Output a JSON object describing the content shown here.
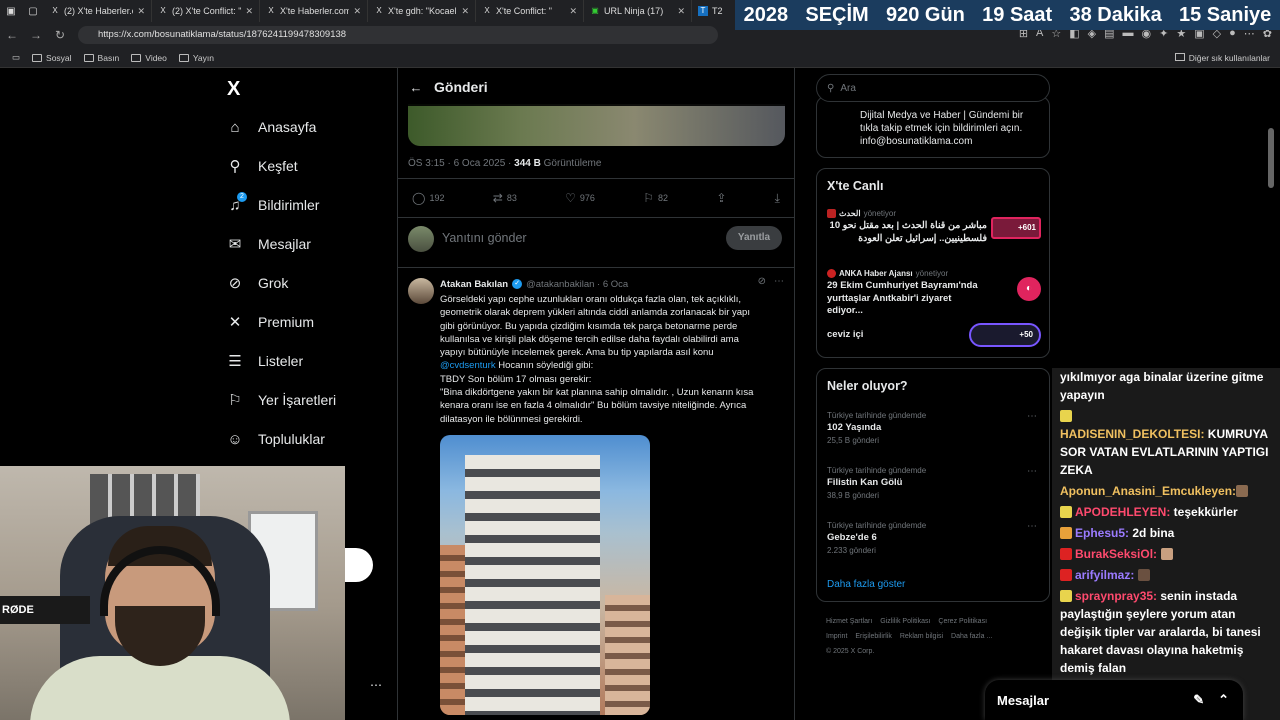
{
  "browser": {
    "tabs": [
      {
        "icon": "X",
        "label": "(2) X'te Haberler.co"
      },
      {
        "icon": "X",
        "label": "(2) X'te Conflict: \""
      },
      {
        "icon": "X",
        "label": "X'te Haberler.com:"
      },
      {
        "icon": "X",
        "label": "X'te gdh: \"Kocaeli"
      },
      {
        "icon": "X",
        "label": "X'te Conflict: \""
      },
      {
        "icon": "▣",
        "label": "URL Ninja (17)"
      },
      {
        "icon": "T",
        "label": "T2"
      }
    ],
    "url": "https://x.com/bosunatiklama/status/1876241199478309138",
    "bookmarks": [
      "Sosyal",
      "Basın",
      "Video",
      "Yayın"
    ],
    "bookmarks_other": "Diğer sık kullanılanlar"
  },
  "countdown": {
    "year": "2028",
    "label": "SEÇİM",
    "days": "920 Gün",
    "hours": "19 Saat",
    "minutes": "38 Dakika",
    "seconds": "15 Saniye"
  },
  "sidebar": {
    "logo": "X",
    "items": [
      {
        "label": "Anasayfa",
        "icon": "home-icon"
      },
      {
        "label": "Keşfet",
        "icon": "search-icon"
      },
      {
        "label": "Bildirimler",
        "icon": "bell-icon",
        "badge": "2"
      },
      {
        "label": "Mesajlar",
        "icon": "mail-icon"
      },
      {
        "label": "Grok",
        "icon": "grok-icon"
      },
      {
        "label": "Premium",
        "icon": "x-icon"
      },
      {
        "label": "Listeler",
        "icon": "list-icon"
      },
      {
        "label": "Yer İşaretleri",
        "icon": "bookmark-icon"
      },
      {
        "label": "Topluluklar",
        "icon": "people-icon"
      }
    ],
    "more": "..."
  },
  "post": {
    "header_title": "Gönderi",
    "time": "ÖS 3:15 · 6 Oca 2025 ·",
    "views": "344 B",
    "views_label": "Görüntüleme",
    "replies": "192",
    "reposts": "83",
    "likes": "976",
    "bookmarks": "82",
    "reply_placeholder": "Yanıtını gönder",
    "reply_button": "Yanıtla"
  },
  "reply_tweet": {
    "name": "Atakan Bakılan",
    "handle": "@atakanbakilan · 6 Oca",
    "lines": [
      "Görseldeki yapı cephe uzunlukları oranı oldukça fazla olan, tek açıklıklı,",
      "geometrik olarak deprem yükleri altında ciddi anlamda zorlanacak bir yapı",
      "gibi görünüyor. Bu yapıda çizdiğim kısımda tek parça betonarme perde",
      "kullanılsa ve kirişli plak döşeme tercih edilse daha faydalı olabilirdi ama",
      "yapıyı bütünüyle incelemek gerek. Ama bu tip yapılarda asıl konu"
    ],
    "mention": "@cvdsenturk",
    "mention_rest": " Hocanın söylediği gibi:",
    "lines2": [
      " TBDY Son bölüm 17 olması gerekir:",
      "\"Bina dikdörtgene yakın bir kat planına sahip olmalıdır. , Uzun kenarın kısa",
      "kenara oranı ise en fazla 4 olmalıdır\" Bu bölüm tavsiye niteliğinde. Ayrıca",
      "dilatasyon ile bölünmesi gerekirdi."
    ]
  },
  "right": {
    "search_placeholder": "Ara",
    "promo_text": "Dijital Medya ve Haber | Gündemi bir tıkla takip etmek için bildirimleri açın. info@bosunatiklama.com",
    "live_title": "X'te Canlı",
    "live": [
      {
        "host": "الحدث",
        "role": "yönetiyor",
        "title": "مباشر من قناة الحدث | بعد مقتل نحو 10 فلسطينيين.. إسرائيل تعلن العودة",
        "count": "+601"
      },
      {
        "host": "ANKA Haber Ajansı",
        "role": "yönetiyor",
        "title": "29 Ekim Cumhuriyet Bayramı'nda yurttaşlar Anıtkabir'i ziyaret ediyor..."
      },
      {
        "host": "",
        "role": "",
        "title": "ceviz içi",
        "count": "+50"
      }
    ],
    "trends_title": "Neler oluyor?",
    "trends": [
      {
        "category": "Türkiye tarihinde gündemde",
        "name": "102 Yaşında",
        "count": "25,5 B gönderi"
      },
      {
        "category": "Türkiye tarihinde gündemde",
        "name": "Filistin Kan Gölü",
        "count": "38,9 B gönderi"
      },
      {
        "category": "Türkiye tarihinde gündemde",
        "name": "Gebze'de 6",
        "count": "2.233 gönderi"
      }
    ],
    "show_more": "Daha fazla göster",
    "footer": [
      "Hizmet Şartları",
      "Gizlilik Politikası",
      "Çerez Politikası",
      "Imprint",
      "Erişilebilirlik",
      "Reklam bilgisi",
      "Daha fazla ...",
      "© 2025 X Corp."
    ]
  },
  "chat": {
    "messages": [
      {
        "user": "",
        "text": "yıkılmıyor aga binalar üzerine gitme yapayın",
        "ucolor": "#ffffff"
      },
      {
        "user": "HADISENIN_DEKOLTESI:",
        "text": " KUMRUYA SOR VATAN EVLATLARININ YAPTIGI ZEKA",
        "ucolor": "#f0c060"
      },
      {
        "user": "Aponun_Anasini_Emcukleyen:",
        "text": "",
        "ucolor": "#f0c060"
      },
      {
        "user": "APODEHLEYEN:",
        "text": " teşekkürler",
        "ucolor": "#ff4a6e"
      },
      {
        "user": "Ephesu5:",
        "text": " 2d bina",
        "ucolor": "#9b7bff"
      },
      {
        "user": "BurakSeksiOl:",
        "text": "",
        "ucolor": "#ff4a6e"
      },
      {
        "user": "arifyilmaz:",
        "text": "",
        "ucolor": "#9b7bff"
      },
      {
        "user": "spraynpray35:",
        "text": " senin instada paylaştığın şeylere yorum atan değişik tipler var aralarda, bi tanesi hakaret davası olayına haketmiş demiş falan",
        "ucolor": "#ff4a6e"
      }
    ]
  },
  "dock": {
    "label": "Mesajlar"
  },
  "webcam": {
    "mic_brand": "RØDE"
  }
}
